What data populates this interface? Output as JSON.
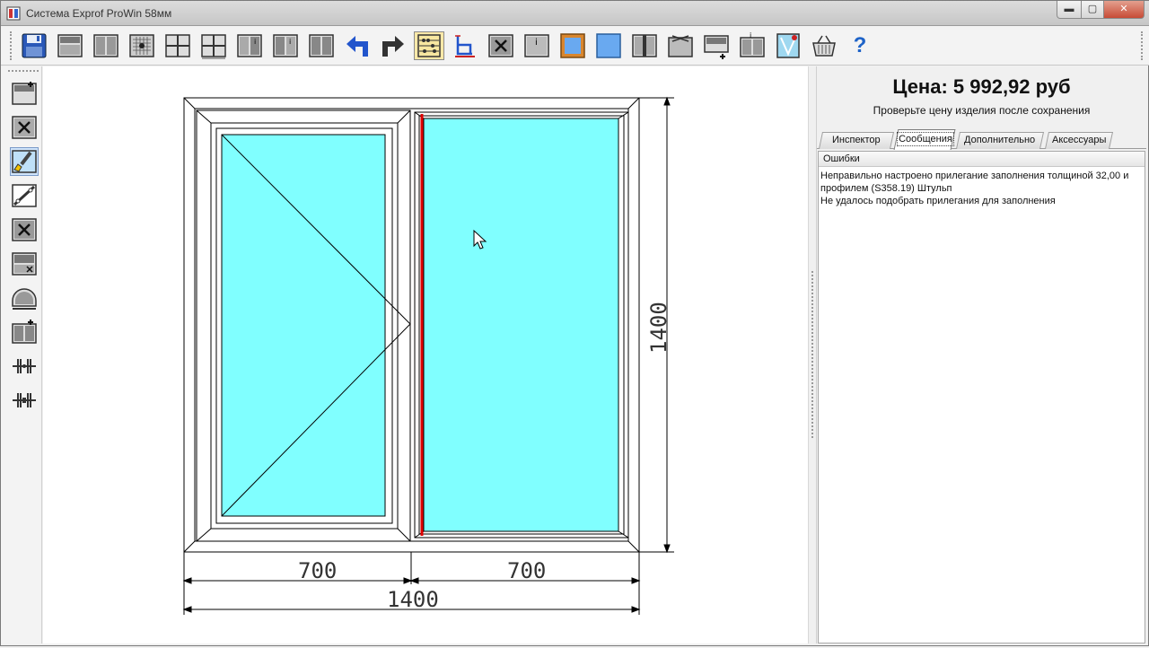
{
  "window": {
    "title": "Система Exprof ProWin 58мм",
    "min_label": "▬",
    "max_label": "▢",
    "close_label": "✕"
  },
  "toolbar": {
    "items": [
      {
        "name": "save-icon"
      },
      {
        "name": "horizontal-split-icon"
      },
      {
        "name": "vertical-split-icon"
      },
      {
        "name": "mosquito-net-icon"
      },
      {
        "name": "impost-cross-icon"
      },
      {
        "name": "grid-split-icon"
      },
      {
        "name": "sash-info-icon"
      },
      {
        "name": "sash-info-alt-icon"
      },
      {
        "name": "double-sash-icon"
      },
      {
        "name": "undo-icon"
      },
      {
        "name": "redo-icon"
      },
      {
        "name": "abacus-icon"
      },
      {
        "name": "profile-chair-icon"
      },
      {
        "name": "delete-sash-icon"
      },
      {
        "name": "properties-icon"
      },
      {
        "name": "glass-frame-icon"
      },
      {
        "name": "glass-icon"
      },
      {
        "name": "shtulp-icon"
      },
      {
        "name": "sill-icon"
      },
      {
        "name": "add-sill-icon"
      },
      {
        "name": "window-info-icon"
      },
      {
        "name": "validate-icon"
      },
      {
        "name": "basket-icon"
      },
      {
        "name": "help-icon"
      }
    ],
    "help_label": "?"
  },
  "left_toolbar": {
    "items": [
      {
        "name": "add-frame-icon"
      },
      {
        "name": "delete-element-icon"
      },
      {
        "name": "paint-brush-icon"
      },
      {
        "name": "diagonal-impost-icon"
      },
      {
        "name": "remove-impost-icon"
      },
      {
        "name": "edit-sash-icon"
      },
      {
        "name": "arch-icon"
      },
      {
        "name": "add-sash-icon"
      },
      {
        "name": "connector-icon"
      },
      {
        "name": "coupling-icon"
      }
    ],
    "active_index": 2
  },
  "drawing": {
    "left_width": "700",
    "right_width": "700",
    "total_width": "1400",
    "height": "1400",
    "glass_color": "#80ffff",
    "shtulp_color": "#e00000"
  },
  "right_panel": {
    "price": "Цена: 5 992,92 руб",
    "price_note": "Проверьте цену изделия после сохранения",
    "tabs": [
      "Инспектор",
      "Сообщения",
      "Дополнительно",
      "Аксессуары"
    ],
    "selected_tab": 1,
    "messages_header": "Ошибки",
    "messages": [
      "Неправильно настроено прилегание заполнения толщиной 32,00 и",
      "профилем (S358.19) Штульп",
      "Не удалось подобрать прилегания для заполнения"
    ]
  }
}
